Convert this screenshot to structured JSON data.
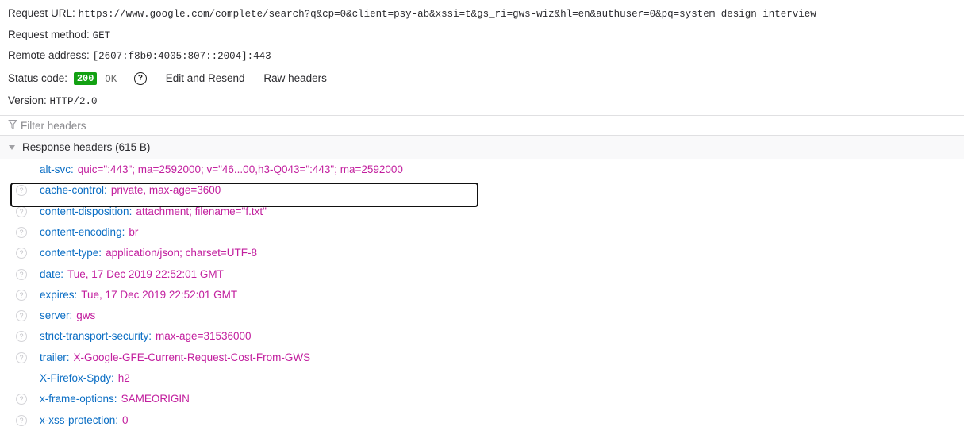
{
  "summary": {
    "request_url_label": "Request URL:",
    "request_url": "https://www.google.com/complete/search?q&cp=0&client=psy-ab&xssi=t&gs_ri=gws-wiz&hl=en&authuser=0&pq=system design interview",
    "request_method_label": "Request method:",
    "request_method": "GET",
    "remote_address_label": "Remote address:",
    "remote_address": "[2607:f8b0:4005:807::2004]:443",
    "status_code_label": "Status code:",
    "status_code": "200",
    "status_text": "OK",
    "status_badge_color": "#12a112",
    "help_icon": "question-circle-icon",
    "edit_resend_label": "Edit and Resend",
    "raw_headers_label": "Raw headers",
    "version_label": "Version:",
    "version": "HTTP/2.0"
  },
  "filter": {
    "placeholder": "Filter headers",
    "value": "",
    "icon": "funnel-icon"
  },
  "response_headers": {
    "title": "Response headers (615 B)",
    "expanded": true,
    "highlighted_header": "cache-control",
    "name_color": "#0b6ec4",
    "value_color": "#c21f9e",
    "items": [
      {
        "name": "alt-svc",
        "value": "quic=\":443\"; ma=2592000; v=\"46...00,h3-Q043=\":443\"; ma=2592000",
        "has_help_icon": false
      },
      {
        "name": "cache-control",
        "value": "private, max-age=3600",
        "has_help_icon": true
      },
      {
        "name": "content-disposition",
        "value": "attachment; filename=\"f.txt\"",
        "has_help_icon": true
      },
      {
        "name": "content-encoding",
        "value": "br",
        "has_help_icon": true
      },
      {
        "name": "content-type",
        "value": "application/json; charset=UTF-8",
        "has_help_icon": true
      },
      {
        "name": "date",
        "value": "Tue, 17 Dec 2019 22:52:01 GMT",
        "has_help_icon": true
      },
      {
        "name": "expires",
        "value": "Tue, 17 Dec 2019 22:52:01 GMT",
        "has_help_icon": true
      },
      {
        "name": "server",
        "value": "gws",
        "has_help_icon": true
      },
      {
        "name": "strict-transport-security",
        "value": "max-age=31536000",
        "has_help_icon": true
      },
      {
        "name": "trailer",
        "value": "X-Google-GFE-Current-Request-Cost-From-GWS",
        "has_help_icon": true
      },
      {
        "name": "X-Firefox-Spdy",
        "value": "h2",
        "has_help_icon": false
      },
      {
        "name": "x-frame-options",
        "value": "SAMEORIGIN",
        "has_help_icon": true
      },
      {
        "name": "x-xss-protection",
        "value": "0",
        "has_help_icon": true
      }
    ]
  }
}
